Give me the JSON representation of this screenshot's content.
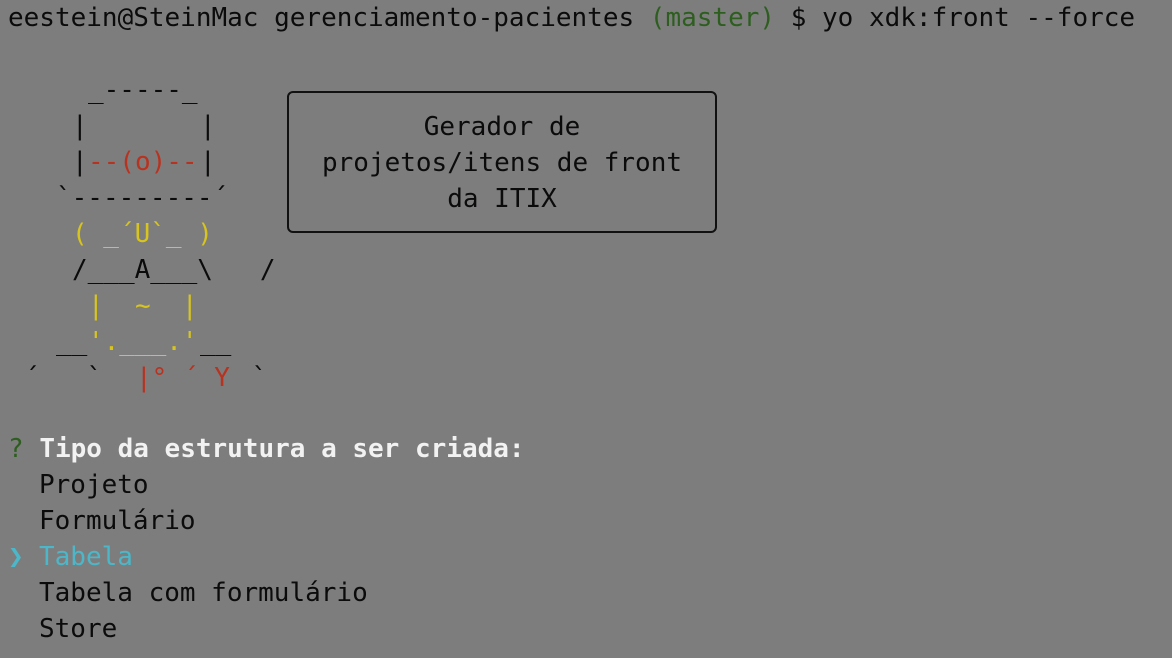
{
  "terminal": {
    "prompt": {
      "user_host": "eestein@SteinMac",
      "cwd": "gerenciamento-pacientes",
      "branch": "(master)",
      "symbol": "$",
      "command": "yo xdk:front --force"
    },
    "mascot": {
      "line1": "_-----_",
      "line2a": "|",
      "line2b": "|",
      "line3a": "|",
      "line3b": "--(o)--",
      "line3c": "|",
      "line4": "`---------´",
      "line5": "( _´U`_ )",
      "line6": "/___A___\\   /",
      "line7": "|  ~  |",
      "line8a": "__",
      "line8b": "'.___.'",
      "line8c": "__",
      "line9a": "´   `  ",
      "line9b": "|° ´ Y",
      "line9c": " `"
    },
    "speech": {
      "line1": "Gerador de",
      "line2": "projetos/itens de front",
      "line3": "da ITIX"
    },
    "question": {
      "marker": "?",
      "text": "Tipo da estrutura a ser criada:"
    },
    "pointer": "❯",
    "choices": [
      "Projeto",
      "Formulário",
      "Tabela",
      "Tabela com formulário",
      "Store"
    ],
    "colors": {
      "background": "#7e7d7e",
      "branch": "#2d5e1f",
      "selected": "#4bb7c8",
      "mascot_red": "#b8331f",
      "mascot_yellow": "#d7c41e"
    }
  }
}
